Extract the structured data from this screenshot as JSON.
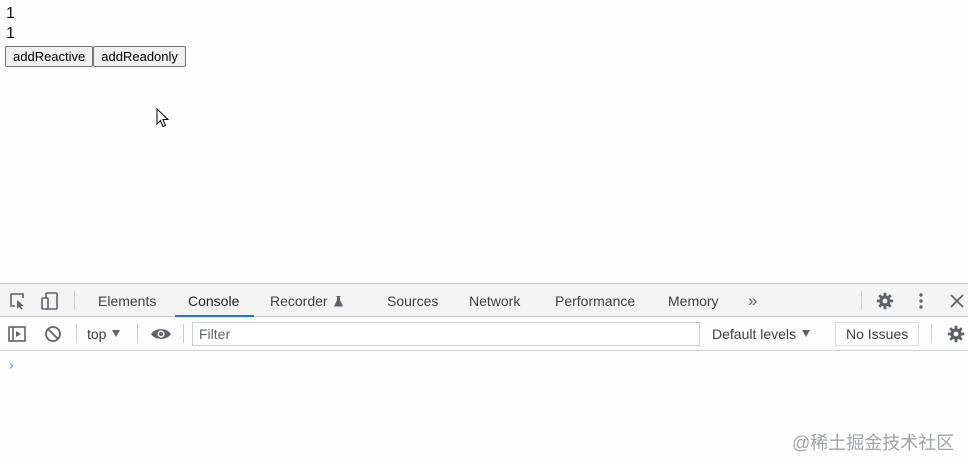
{
  "page": {
    "reactive_count": "1",
    "readonly_count": "1",
    "buttons": {
      "add_reactive": "addReactive",
      "add_readonly": "addReadonly"
    }
  },
  "devtools": {
    "tabs": [
      {
        "label": "Elements"
      },
      {
        "label": "Console",
        "active": true
      },
      {
        "label": "Recorder"
      },
      {
        "label": "Sources"
      },
      {
        "label": "Network"
      },
      {
        "label": "Performance"
      },
      {
        "label": "Memory"
      }
    ],
    "more_tabs": "»",
    "console": {
      "context": "top",
      "filter_placeholder": "Filter",
      "levels": "Default levels",
      "issues": "No Issues",
      "prompt": "›"
    },
    "accent": "#1a73e8"
  },
  "watermark": "@稀土掘金技术社区"
}
